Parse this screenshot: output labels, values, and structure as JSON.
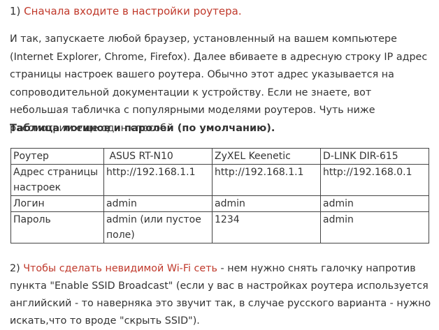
{
  "step1": {
    "heading": "1) Сначала входите в настройки роутера.",
    "number_prefix": "1) ",
    "title_rest": "Сначала входите в настройки роутера."
  },
  "intro_text": "И так, запускаете любой браузер, установленный на вашем компьютере (Internet Explorer, Chrome, Firefox). Далее вбиваете в адресную строку IP адрес страницы настроек вашего роутера. Обычно этот адрес указывается на сопроводительной документации к устройству. Если не знаете, вот небольшая табличка с популярными моделями роутеров. Чуть ниже рассмотрим еще один способ.",
  "table_title": "Таблица логинов и паролей (по умолчанию).",
  "table": {
    "header": [
      "Роутер",
      " ASUS RT-N10",
      "ZyXEL Keenetic",
      "D-LINK DIR-615"
    ],
    "rows": [
      [
        "Адрес страницы настроек",
        "http://192.168.1.1",
        "http://192.168.1.1",
        "http://192.168.0.1"
      ],
      [
        "Логин",
        "admin",
        "admin",
        "admin"
      ],
      [
        "Пароль",
        "admin (или пустое поле)",
        "1234",
        "admin"
      ]
    ]
  },
  "step2": {
    "number_prefix": "2) ",
    "accent_text": "Чтобы сделать невидимой Wi-Fi сеть",
    "rest_text": " - нем нужно снять галочку напротив пункта \"Enable SSID Broadcast\" (если у вас в настройках роутера используется английский - то наверняка это звучит так, в случае русского варианта - нужно искать,что то вроде \"скрыть SSID\")."
  },
  "colors": {
    "accent": "#c0392b",
    "text": "#333333",
    "border": "#444444"
  }
}
